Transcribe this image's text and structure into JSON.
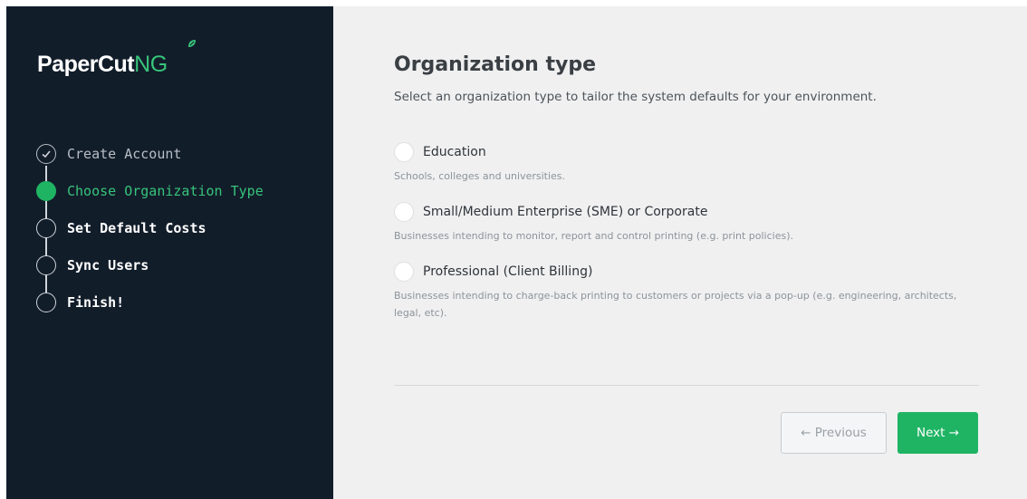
{
  "brand": {
    "logo_main": "PaperCut",
    "logo_suffix": "NG",
    "accent": "#37c47a"
  },
  "steps": [
    {
      "label": "Create Account",
      "state": "done",
      "icon": "check-circle-icon"
    },
    {
      "label": "Choose Organization Type",
      "state": "active",
      "icon": "filled-circle-icon"
    },
    {
      "label": "Set Default Costs",
      "state": "todo",
      "icon": "empty-circle-icon"
    },
    {
      "label": "Sync Users",
      "state": "todo",
      "icon": "empty-circle-icon"
    },
    {
      "label": "Finish!",
      "state": "todo",
      "icon": "empty-circle-icon"
    }
  ],
  "main": {
    "title": "Organization type",
    "subtitle": "Select an organization type to tailor the system defaults for your environment.",
    "options": [
      {
        "label": "Education",
        "description": "Schools, colleges and universities.",
        "selected": false
      },
      {
        "label": "Small/Medium Enterprise (SME) or Corporate",
        "description": "Businesses intending to monitor, report and control printing (e.g. print policies).",
        "selected": false
      },
      {
        "label": "Professional (Client Billing)",
        "description": "Businesses intending to charge-back printing to customers or projects via a pop-up (e.g. engineering, architects, legal, etc).",
        "selected": false
      }
    ]
  },
  "buttons": {
    "previous_label": "← Previous",
    "next_label": "Next →",
    "next_color": "#1fb463"
  }
}
